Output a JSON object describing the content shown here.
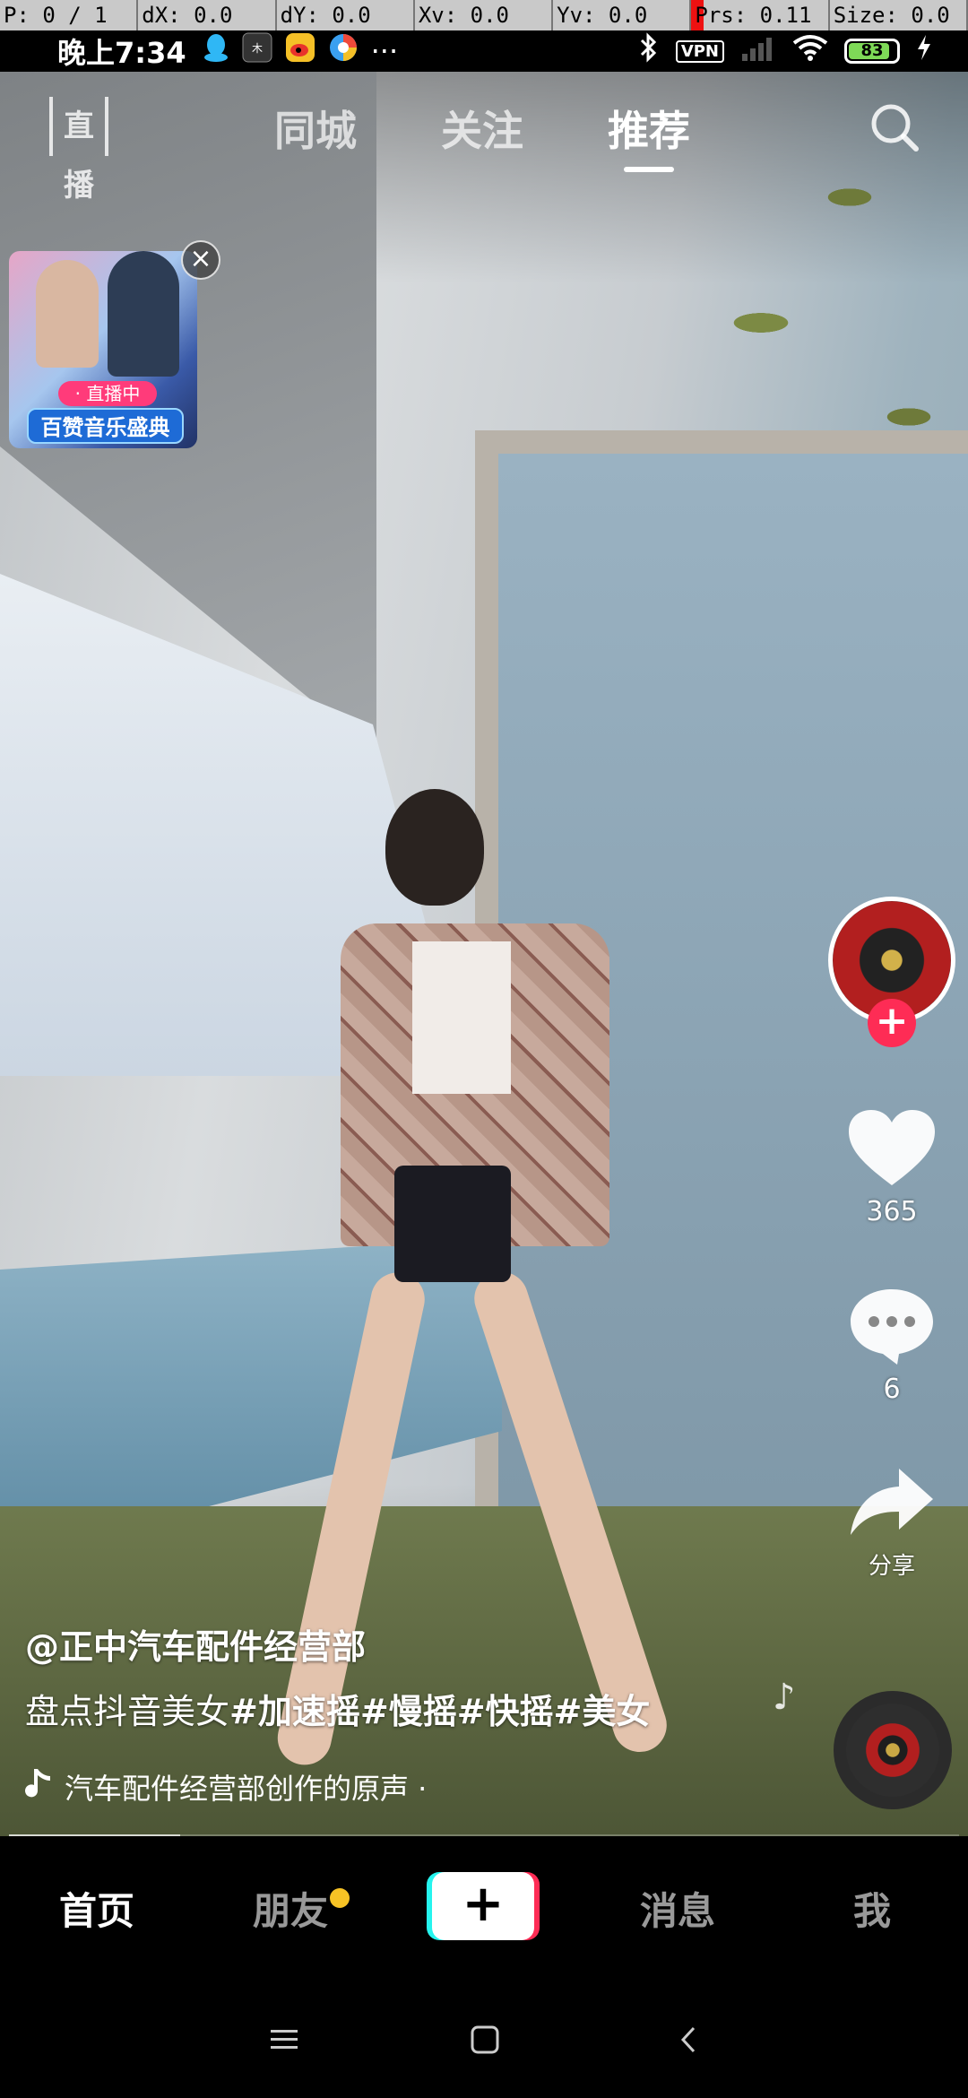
{
  "debug_bar": {
    "pointer": "P: 0 / 1",
    "dx": "dX: 0.0",
    "dy": "dY: 0.0",
    "xv": "Xv: 0.0",
    "yv": "Yv: 0.0",
    "prs": "Prs: 0.11",
    "size": "Size: 0.0"
  },
  "status_bar": {
    "time": "晚上7:34",
    "notification_icons": [
      "qq-icon",
      "app-icon",
      "weibo-icon",
      "browser-icon",
      "more-icon"
    ],
    "more": "···",
    "vpn": "VPN",
    "battery": "83"
  },
  "top_nav": {
    "live_label": "直播",
    "tabs": [
      {
        "label": "同城",
        "active": false
      },
      {
        "label": "关注",
        "active": false
      },
      {
        "label": "推荐",
        "active": true
      }
    ]
  },
  "live_ad": {
    "live_tag": "· 直播中",
    "title": "百赞音乐盛典"
  },
  "actions": {
    "likes": "365",
    "comments": "6",
    "share_label": "分享"
  },
  "video_info": {
    "author": "@正中汽车配件经营部",
    "caption_prefix": "盘点抖音美女",
    "caption_tags": "#加速摇#慢摇#快摇#美女",
    "music": "汽车配件经营部创作的原声 ·",
    "progress": 0.18
  },
  "bottom_nav": {
    "items": [
      {
        "label": "首页",
        "active": true
      },
      {
        "label": "朋友",
        "active": false
      },
      {
        "label": "消息",
        "active": false
      },
      {
        "label": "我",
        "active": false
      }
    ],
    "add_label": "+"
  },
  "colors": {
    "accent_red": "#fe2c55",
    "accent_cyan": "#25f4ee",
    "notification_dot": "#f7c325"
  }
}
